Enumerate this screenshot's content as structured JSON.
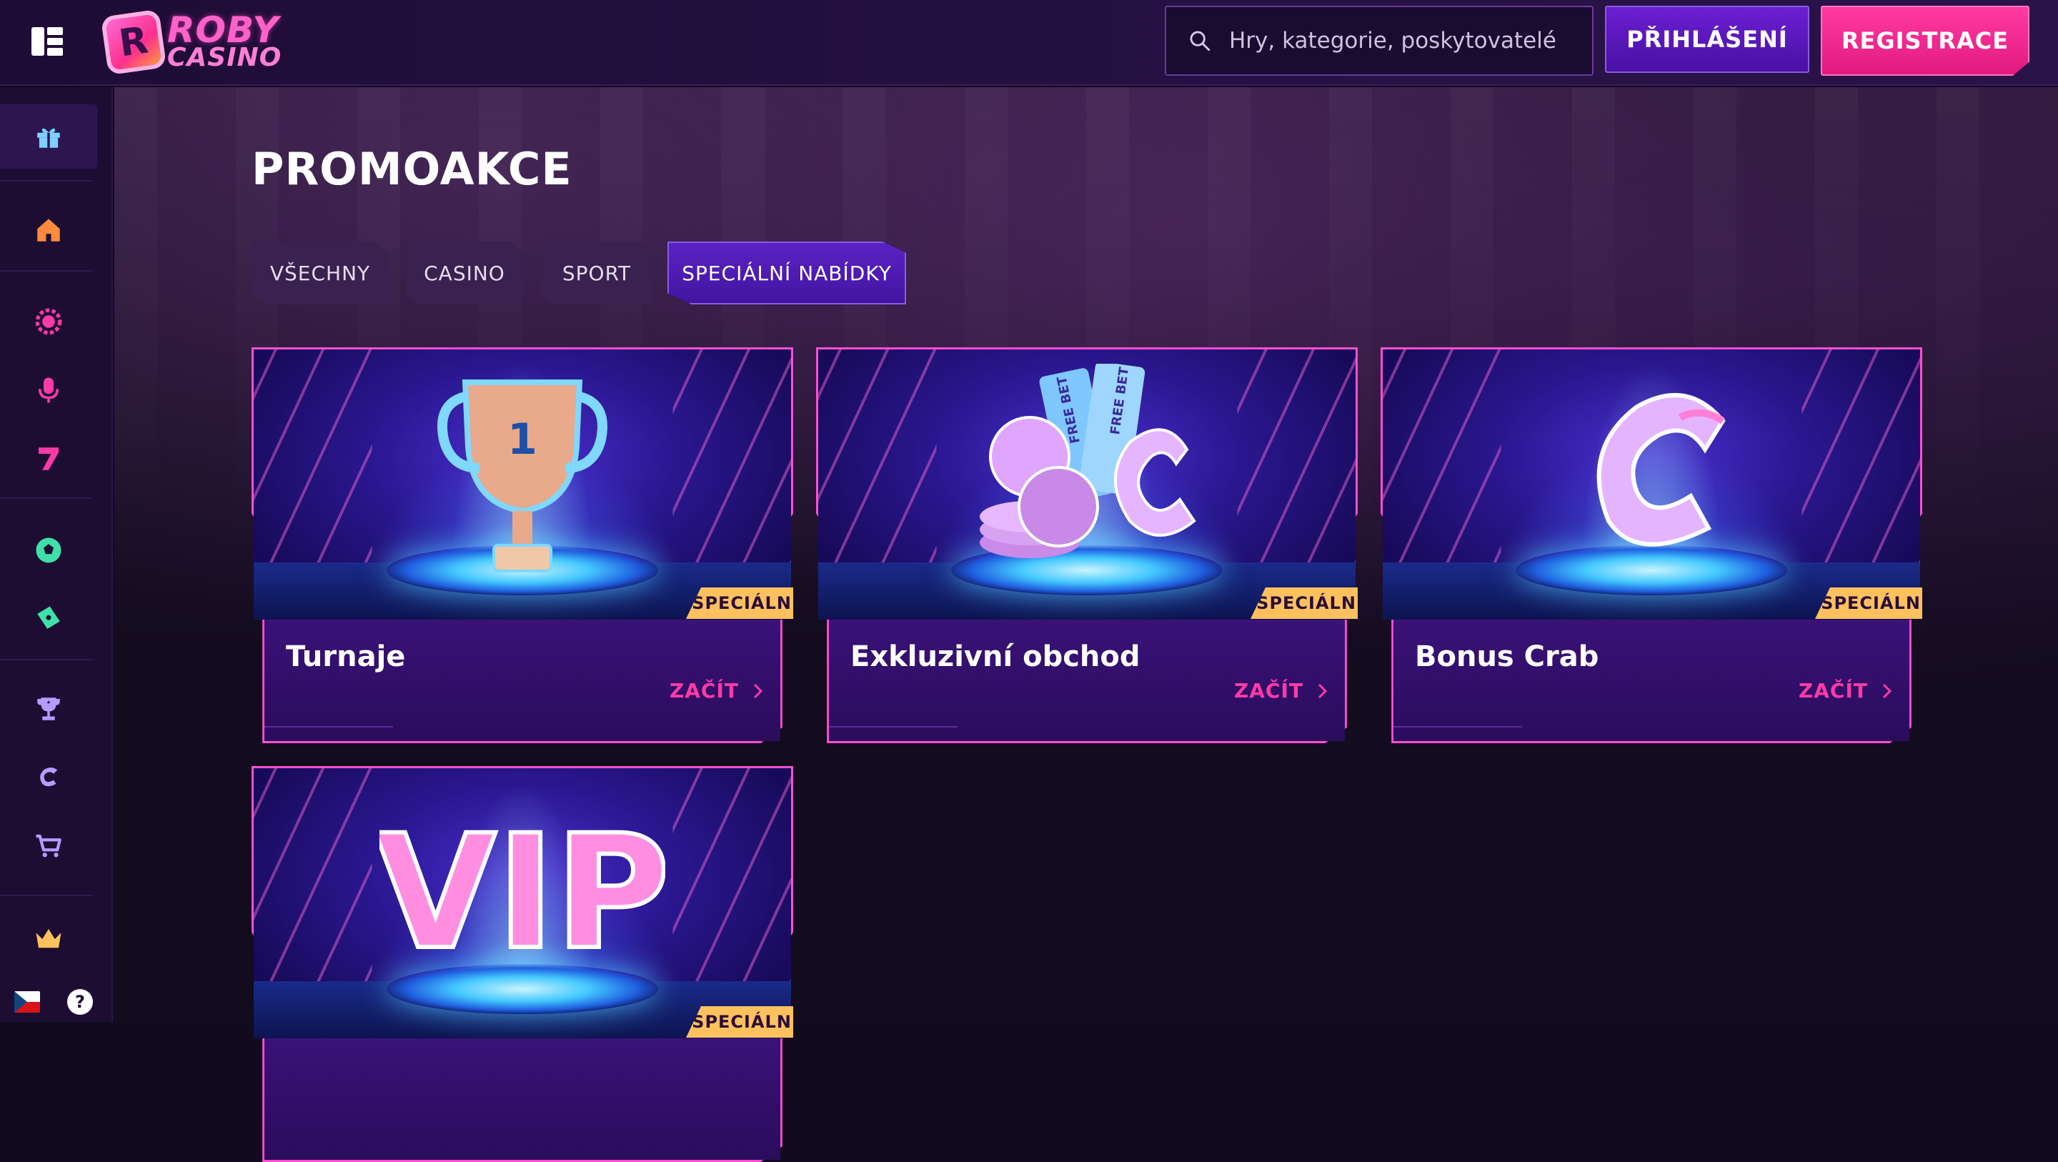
{
  "header": {
    "logo_line1": "ROBY",
    "logo_line2": "CASINO",
    "logo_mark": "R",
    "search_placeholder": "Hry, kategorie, poskytovatelé",
    "login_label": "PŘIHLÁŠENÍ",
    "register_label": "REGISTRACE"
  },
  "sidebar": {
    "icons": [
      "gift-icon",
      "home-icon",
      "live-casino-icon",
      "microphone-icon",
      "slots-seven-icon",
      "soccer-ball-icon",
      "ticket-icon",
      "trophy-icon",
      "crab-c-icon",
      "cart-icon",
      "crown-icon"
    ],
    "language": "CZ",
    "help_label": "?"
  },
  "main": {
    "title": "PROMOAKCE",
    "tabs": [
      {
        "label": "VŠECHNY",
        "active": false
      },
      {
        "label": "CASINO",
        "active": false
      },
      {
        "label": "SPORT",
        "active": false
      },
      {
        "label": "SPECIÁLNÍ NABÍDKY",
        "active": true
      }
    ],
    "cards": [
      {
        "title": "Turnaje",
        "badge": "SPECIÁLNÍ",
        "cta": "ZAČÍT",
        "art": "trophy"
      },
      {
        "title": "Exkluzivní obchod",
        "badge": "SPECIÁLNÍ",
        "cta": "ZAČÍT",
        "art": "coins"
      },
      {
        "title": "Bonus Crab",
        "badge": "SPECIÁLNÍ",
        "cta": "ZAČÍT",
        "art": "crab-c"
      },
      {
        "title": "",
        "badge": "SPECIÁLNÍ",
        "cta": "",
        "art": "vip",
        "art_text": "VIP"
      }
    ],
    "art_labels": {
      "ticket_text": "FREE BET",
      "trophy_number": "1"
    }
  },
  "colors": {
    "accent_pink": "#ff3aa8",
    "accent_purple": "#5a22c4",
    "badge_yellow": "#ffc15e",
    "background": "#120a1f"
  }
}
